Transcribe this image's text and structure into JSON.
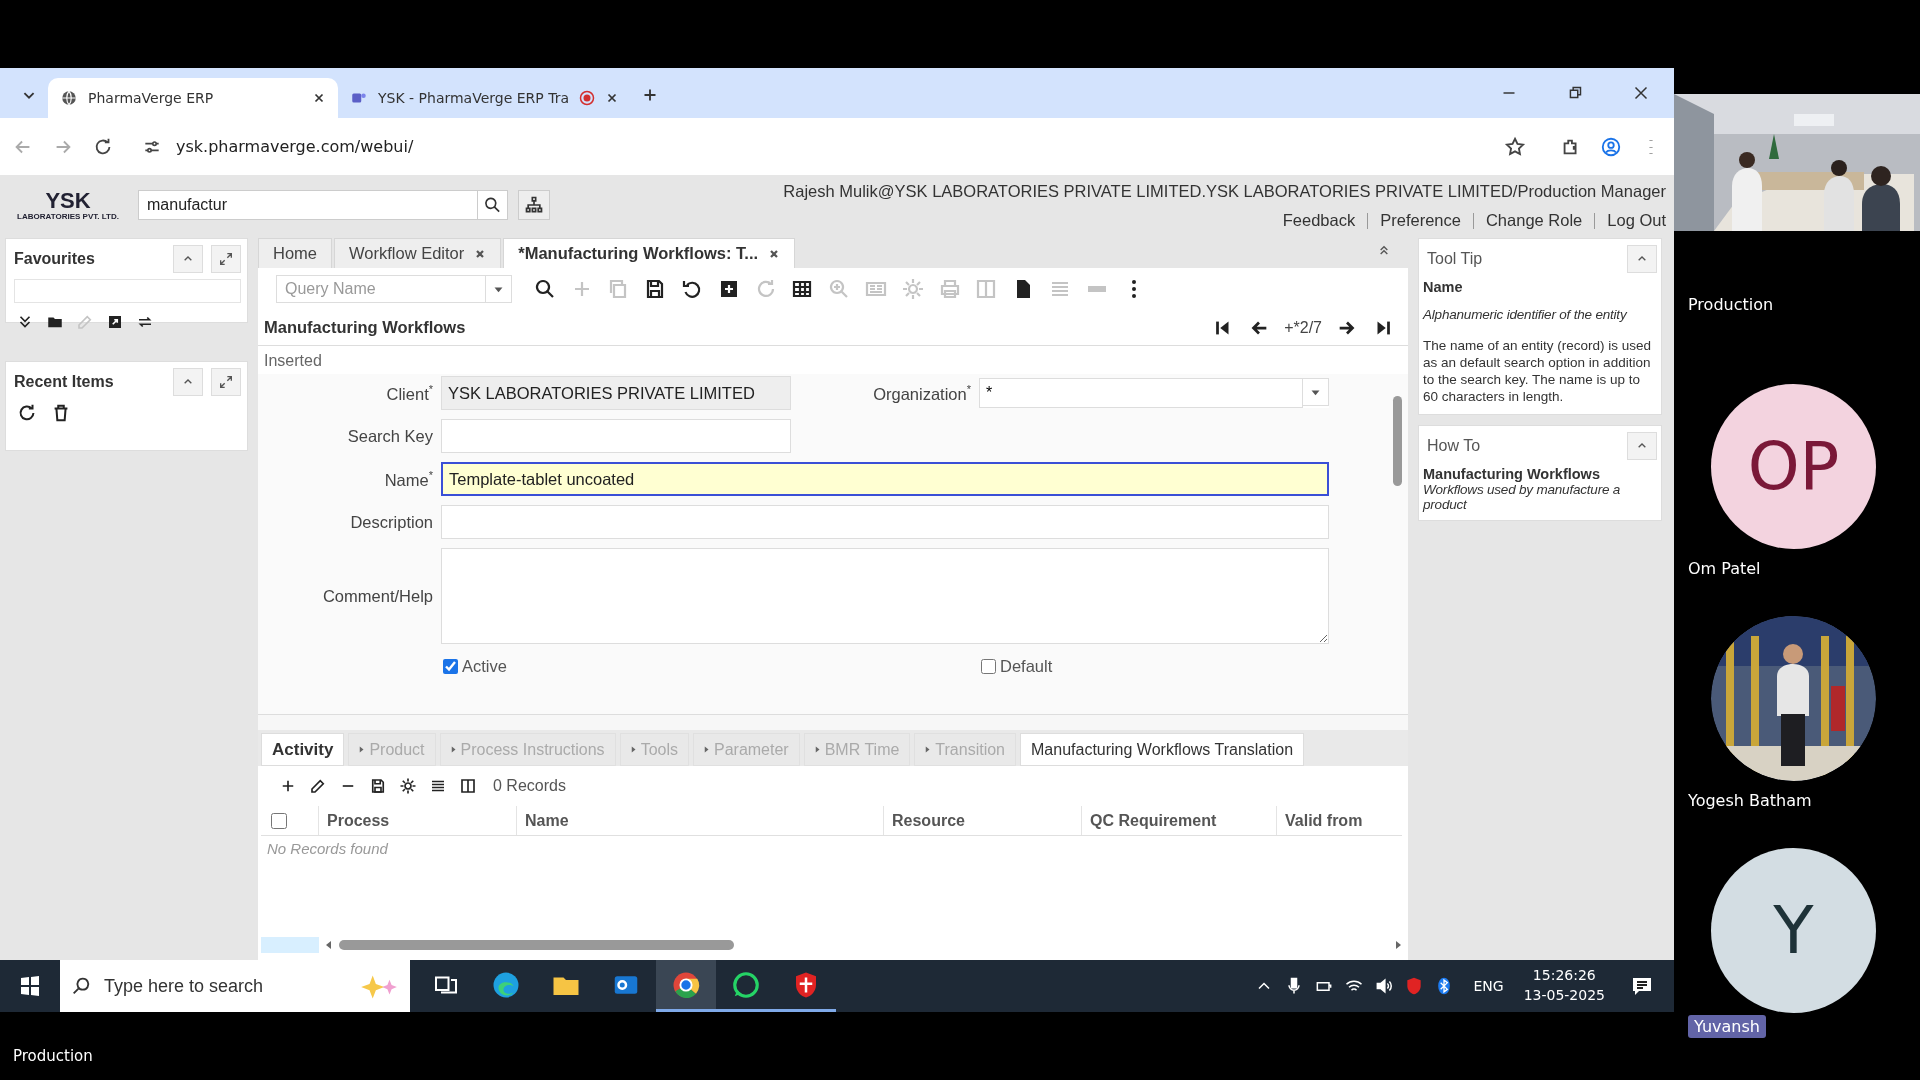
{
  "browser": {
    "tabs": [
      {
        "title": "PharmaVerge ERP",
        "selected": true,
        "kind": "web",
        "recording": false
      },
      {
        "title": "YSK - PharmaVerge ERP Tra",
        "selected": false,
        "kind": "teams",
        "recording": true
      }
    ],
    "url": "ysk.pharmaverge.com/webui/"
  },
  "app": {
    "logo": {
      "name": "YSK",
      "subtitle": "LABORATORIES PVT. LTD."
    },
    "search": {
      "value": "manufactur"
    },
    "user": "Rajesh Mulik@YSK LABORATORIES PRIVATE LIMITED.YSK LABORATORIES PRIVATE LIMITED/Production Manager",
    "links": [
      "Feedback",
      "Preference",
      "Change Role",
      "Log Out"
    ],
    "favourites": {
      "title": "Favourites",
      "tools": [
        {
          "kind": "chevrons",
          "disabled": false
        },
        {
          "kind": "folder",
          "disabled": false
        },
        {
          "kind": "edit",
          "disabled": true
        },
        {
          "kind": "share",
          "disabled": false
        },
        {
          "kind": "swap",
          "disabled": false
        }
      ]
    },
    "recent": {
      "title": "Recent Items",
      "tools": [
        {
          "kind": "refresh",
          "disabled": false
        },
        {
          "kind": "trash",
          "disabled": false
        }
      ]
    },
    "tabs": [
      {
        "label": "Home",
        "selected": false,
        "closable": false
      },
      {
        "label": "Workflow Editor",
        "selected": false,
        "closable": true
      },
      {
        "label": "*Manufacturing Workflows: T...",
        "selected": true,
        "closable": true
      }
    ],
    "query": {
      "placeholder": "Query Name"
    },
    "toolbar": [
      {
        "kind": "search",
        "disabled": false
      },
      {
        "kind": "plus",
        "disabled": true
      },
      {
        "kind": "copy",
        "disabled": true
      },
      {
        "kind": "save",
        "disabled": false
      },
      {
        "kind": "undo",
        "disabled": false
      },
      {
        "kind": "plussq",
        "disabled": false
      },
      {
        "kind": "refresh",
        "disabled": true
      },
      {
        "kind": "table",
        "disabled": false
      },
      {
        "kind": "zoom",
        "disabled": true
      },
      {
        "kind": "report",
        "disabled": true
      },
      {
        "kind": "gear",
        "disabled": true
      },
      {
        "kind": "printer",
        "disabled": true
      },
      {
        "kind": "columns",
        "disabled": true
      },
      {
        "kind": "document",
        "disabled": false
      },
      {
        "kind": "list",
        "disabled": true
      },
      {
        "kind": "pill",
        "disabled": true
      },
      {
        "kind": "more",
        "disabled": false
      }
    ],
    "window_title": "Manufacturing Workflows",
    "record_nav": "+*2/7",
    "status": "Inserted",
    "client": {
      "label": "Client",
      "required": true,
      "value": "YSK LABORATORIES PRIVATE LIMITED"
    },
    "organization": {
      "label": "Organization",
      "required": true,
      "value": "*"
    },
    "search_key": {
      "label": "Search Key",
      "required": false
    },
    "name": {
      "label": "Name",
      "required": true,
      "value": "Template-tablet uncoated",
      "focused": true
    },
    "description": {
      "label": "Description",
      "required": false
    },
    "comment_help": {
      "label": "Comment/Help",
      "required": false
    },
    "active": {
      "label": "Active",
      "checked": true
    },
    "default": {
      "label": "Default",
      "checked": false
    },
    "detail_tabs": [
      {
        "label": "Activity",
        "selected": true,
        "disabled": false
      },
      {
        "label": "Product",
        "selected": false,
        "disabled": true
      },
      {
        "label": "Process Instructions",
        "selected": false,
        "disabled": true
      },
      {
        "label": "Tools",
        "selected": false,
        "disabled": true
      },
      {
        "label": "Parameter",
        "selected": false,
        "disabled": true
      },
      {
        "label": "BMR Time",
        "selected": false,
        "disabled": true
      },
      {
        "label": "Transition",
        "selected": false,
        "disabled": true
      },
      {
        "label": "Manufacturing Workflows Translation",
        "selected": false,
        "disabled": false
      }
    ],
    "records": "0 Records",
    "select_all": {
      "checked": false
    },
    "columns": [
      "Process",
      "Name",
      "Resource",
      "QC Requirement",
      "Valid from"
    ],
    "empty": "No Records found",
    "tooltip": {
      "title": "Tool Tip",
      "heading": "Name",
      "summary": "Alphanumeric identifier of the entity",
      "text": "The name of an entity (record) is used as an default search option in addition to the search key. The name is up to 60 characters in length."
    },
    "howto": {
      "title": "How To",
      "heading": "Manufacturing Workflows",
      "text": "Workflows used by manufacture a product"
    }
  },
  "taskbar": {
    "search_placeholder": "Type here to search",
    "language": "ENG",
    "time": "15:26:26",
    "date": "13-05-2025",
    "apps": [
      {
        "kind": "taskview",
        "running": false,
        "selected": false
      },
      {
        "kind": "edge",
        "running": false,
        "selected": false
      },
      {
        "kind": "explorer",
        "running": false,
        "selected": false
      },
      {
        "kind": "outlook",
        "running": false,
        "selected": false
      },
      {
        "kind": "chrome",
        "running": true,
        "selected": true
      },
      {
        "kind": "whatsapp",
        "running": true,
        "selected": false
      },
      {
        "kind": "shield",
        "running": true,
        "selected": false
      }
    ]
  },
  "call": {
    "stage_label": "Production",
    "self_label": "Production",
    "participants": [
      {
        "name": "Om Patel",
        "kind": "initials",
        "initials": "OP",
        "color": "#f3d3df",
        "highlighted": false
      },
      {
        "name": "Yogesh Batham",
        "highlighted": false
      },
      {
        "name": "Yuvansh",
        "kind": "initials",
        "initials": "Y",
        "color": "#d3dde3",
        "highlighted": true
      }
    ]
  }
}
